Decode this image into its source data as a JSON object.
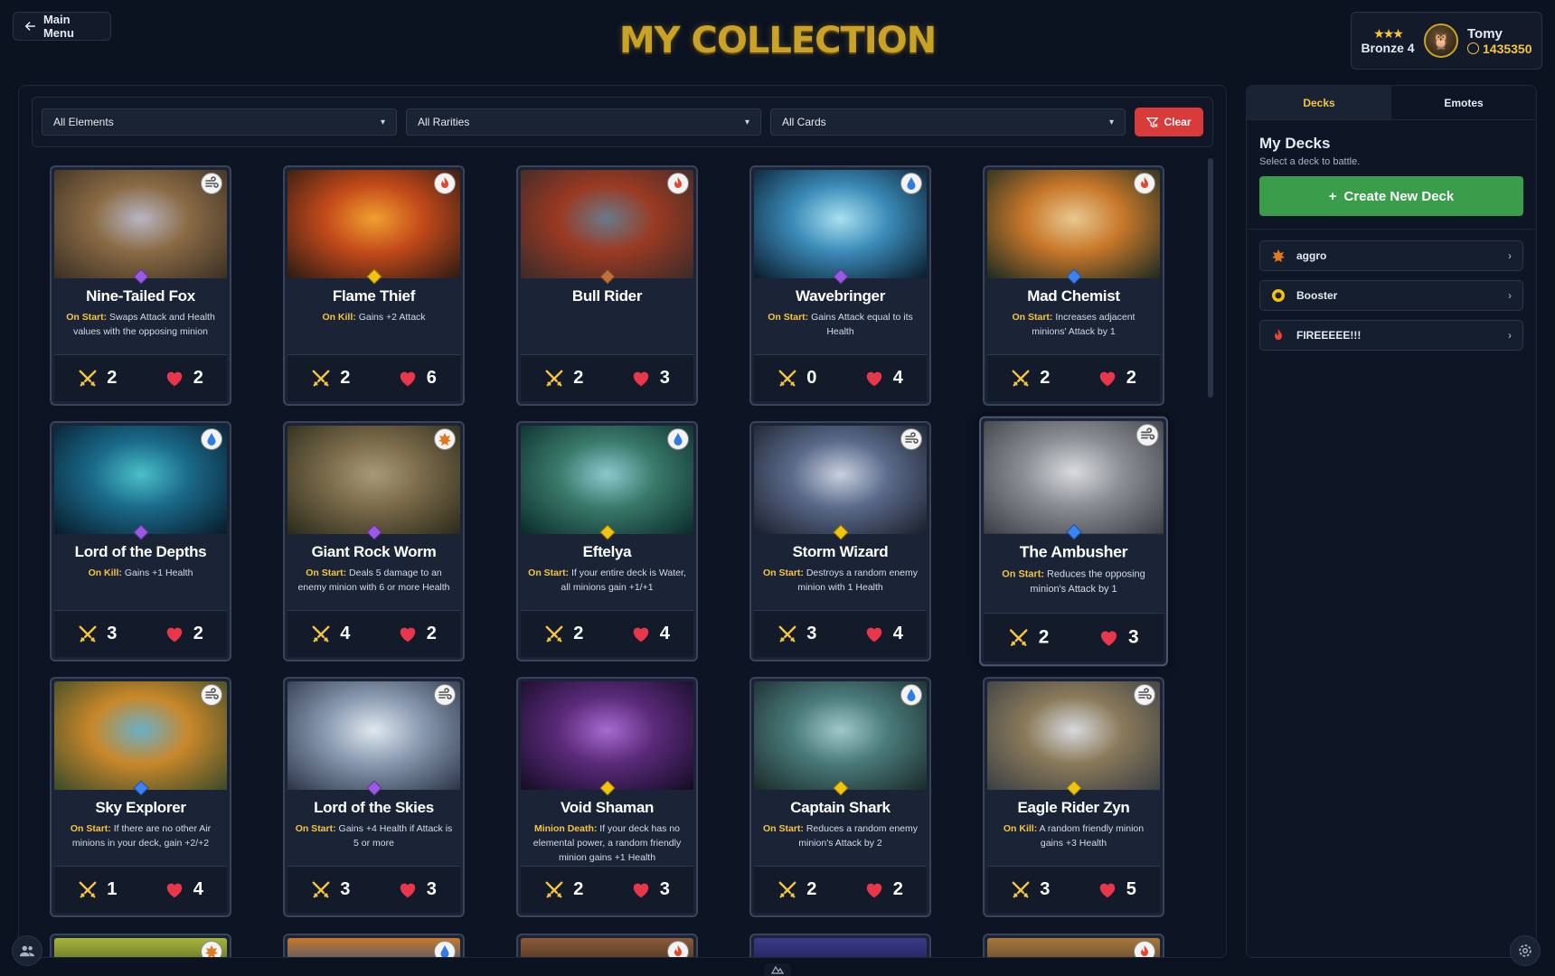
{
  "nav": {
    "back_label": "Main Menu"
  },
  "title": "MY COLLECTION",
  "profile": {
    "rank": "Bronze 4",
    "name": "Tomy",
    "coins": "1435350"
  },
  "filters": {
    "element": "All Elements",
    "rarity": "All Rarities",
    "cards": "All Cards",
    "clear_label": "Clear"
  },
  "colors": {
    "fire": "#e8452c",
    "water": "#2f7de0",
    "air": "#555555",
    "earth": "#e07a1f",
    "rare_epic": "#9b59e6",
    "rare_legend": "#f1c40f",
    "rare_rare": "#3b82f6",
    "rare_common": "#c0703a"
  },
  "cards": [
    {
      "name": "Nine-Tailed Fox",
      "element": "air-icon",
      "rarity": "rare_epic",
      "trigger": "On Start:",
      "text": " Swaps Attack and Health values with the opposing minion",
      "attack": "2",
      "health": "2",
      "art": [
        "#3a2f25",
        "#8a6a44",
        "#b8b6c4"
      ]
    },
    {
      "name": "Flame Thief",
      "element": "fire-icon",
      "rarity": "rare_legend",
      "trigger": "On Kill:",
      "text": " Gains +2 Attack",
      "attack": "2",
      "health": "6",
      "art": [
        "#2a1a14",
        "#c44a1a",
        "#f0a030"
      ]
    },
    {
      "name": "Bull Rider",
      "element": "fire-icon",
      "rarity": "rare_common",
      "trigger": "",
      "text": "",
      "attack": "2",
      "health": "3",
      "art": [
        "#3a2a2a",
        "#9a3a22",
        "#6a7a8a"
      ]
    },
    {
      "name": "Wavebringer",
      "element": "water-icon",
      "rarity": "rare_epic",
      "trigger": "On Start:",
      "text": " Gains Attack equal to its Health",
      "attack": "0",
      "health": "4",
      "art": [
        "#0a1a2a",
        "#3a8ab8",
        "#a8e0f0"
      ]
    },
    {
      "name": "Mad Chemist",
      "element": "fire-icon",
      "rarity": "rare_rare",
      "trigger": "On Start:",
      "text": " Increases adjacent minions' Attack by 1",
      "attack": "2",
      "health": "2",
      "art": [
        "#1a2a22",
        "#c8782a",
        "#e8c890"
      ]
    },
    {
      "name": "Lord of the Depths",
      "element": "water-icon",
      "rarity": "rare_epic",
      "trigger": "On Kill:",
      "text": " Gains +1 Health",
      "attack": "3",
      "health": "2",
      "art": [
        "#081a2a",
        "#1a6a8a",
        "#4ac0c8"
      ]
    },
    {
      "name": "Giant Rock Worm",
      "element": "earth-icon",
      "rarity": "rare_epic",
      "trigger": "On Start:",
      "text": " Deals 5 damage to an enemy minion with 6 or more Health",
      "attack": "4",
      "health": "2",
      "art": [
        "#2a2a1a",
        "#7a6a4a",
        "#a89a78"
      ]
    },
    {
      "name": "Eftelya",
      "element": "water-icon",
      "rarity": "rare_legend",
      "trigger": "On Start:",
      "text": " If your entire deck is Water, all minions gain +1/+1",
      "attack": "2",
      "health": "4",
      "art": [
        "#0a2a2a",
        "#3a7a6a",
        "#8ac8d0"
      ]
    },
    {
      "name": "Storm Wizard",
      "element": "air-icon",
      "rarity": "rare_legend",
      "trigger": "On Start:",
      "text": " Destroys a random enemy minion with 1 Health",
      "attack": "3",
      "health": "4",
      "art": [
        "#1a1e2a",
        "#5a6a8a",
        "#c8d0e0"
      ]
    },
    {
      "name": "The Ambusher",
      "element": "air-icon",
      "rarity": "rare_rare",
      "trigger": "On Start:",
      "text": " Reduces the opposing minion's Attack by 1",
      "attack": "2",
      "health": "3",
      "art": [
        "#3a3e44",
        "#8a8e94",
        "#d8dade"
      ],
      "highlight": true
    },
    {
      "name": "Sky Explorer",
      "element": "air-icon",
      "rarity": "rare_rare",
      "trigger": "On Start:",
      "text": " If there are no other Air minions in your deck, gain +2/+2",
      "attack": "1",
      "health": "4",
      "art": [
        "#3a4a2a",
        "#c8882a",
        "#6ab0c8"
      ]
    },
    {
      "name": "Lord of the Skies",
      "element": "air-icon",
      "rarity": "rare_epic",
      "trigger": "On Start:",
      "text": " Gains +4 Health if Attack is 5 or more",
      "attack": "3",
      "health": "3",
      "art": [
        "#2a3448",
        "#8a9ab0",
        "#e0e8f0"
      ]
    },
    {
      "name": "Void Shaman",
      "element": "",
      "rarity": "rare_legend",
      "trigger": "Minion Death:",
      "text": " If your deck has no elemental power, a random friendly minion gains +1 Health",
      "attack": "2",
      "health": "3",
      "art": [
        "#140c24",
        "#5a2a7a",
        "#a86ad0"
      ]
    },
    {
      "name": "Captain Shark",
      "element": "water-icon",
      "rarity": "rare_legend",
      "trigger": "On Start:",
      "text": " Reduces a random enemy minion's Attack by 2",
      "attack": "2",
      "health": "2",
      "art": [
        "#1a2a2a",
        "#4a7a7a",
        "#a0c8c8"
      ]
    },
    {
      "name": "Eagle Rider Zyn",
      "element": "air-icon",
      "rarity": "rare_legend",
      "trigger": "On Kill:",
      "text": " A random friendly minion gains +3 Health",
      "attack": "3",
      "health": "5",
      "art": [
        "#3a3e44",
        "#8a7a5a",
        "#d8dade"
      ]
    }
  ],
  "partial_cards": [
    {
      "element": "earth-icon",
      "art": [
        "#4a5a1a",
        "#a8b43a"
      ]
    },
    {
      "element": "water-icon",
      "art": [
        "#1a4a8a",
        "#c8782a"
      ]
    },
    {
      "element": "fire-icon",
      "art": [
        "#3a2a1a",
        "#8a5a3a"
      ]
    },
    {
      "element": "",
      "art": [
        "#1a1a4a",
        "#3a3a8a"
      ]
    },
    {
      "element": "fire-icon",
      "art": [
        "#4a3a2a",
        "#a8783a"
      ]
    }
  ],
  "side": {
    "tabs": [
      "Decks",
      "Emotes"
    ],
    "title": "My Decks",
    "subtitle": "Select a deck to battle.",
    "create_label": "Create New Deck",
    "decks": [
      {
        "name": "aggro",
        "icon": "earth-icon"
      },
      {
        "name": "Booster",
        "icon": "coin-icon"
      },
      {
        "name": "FIREEEEE!!!",
        "icon": "fire-icon"
      }
    ]
  }
}
